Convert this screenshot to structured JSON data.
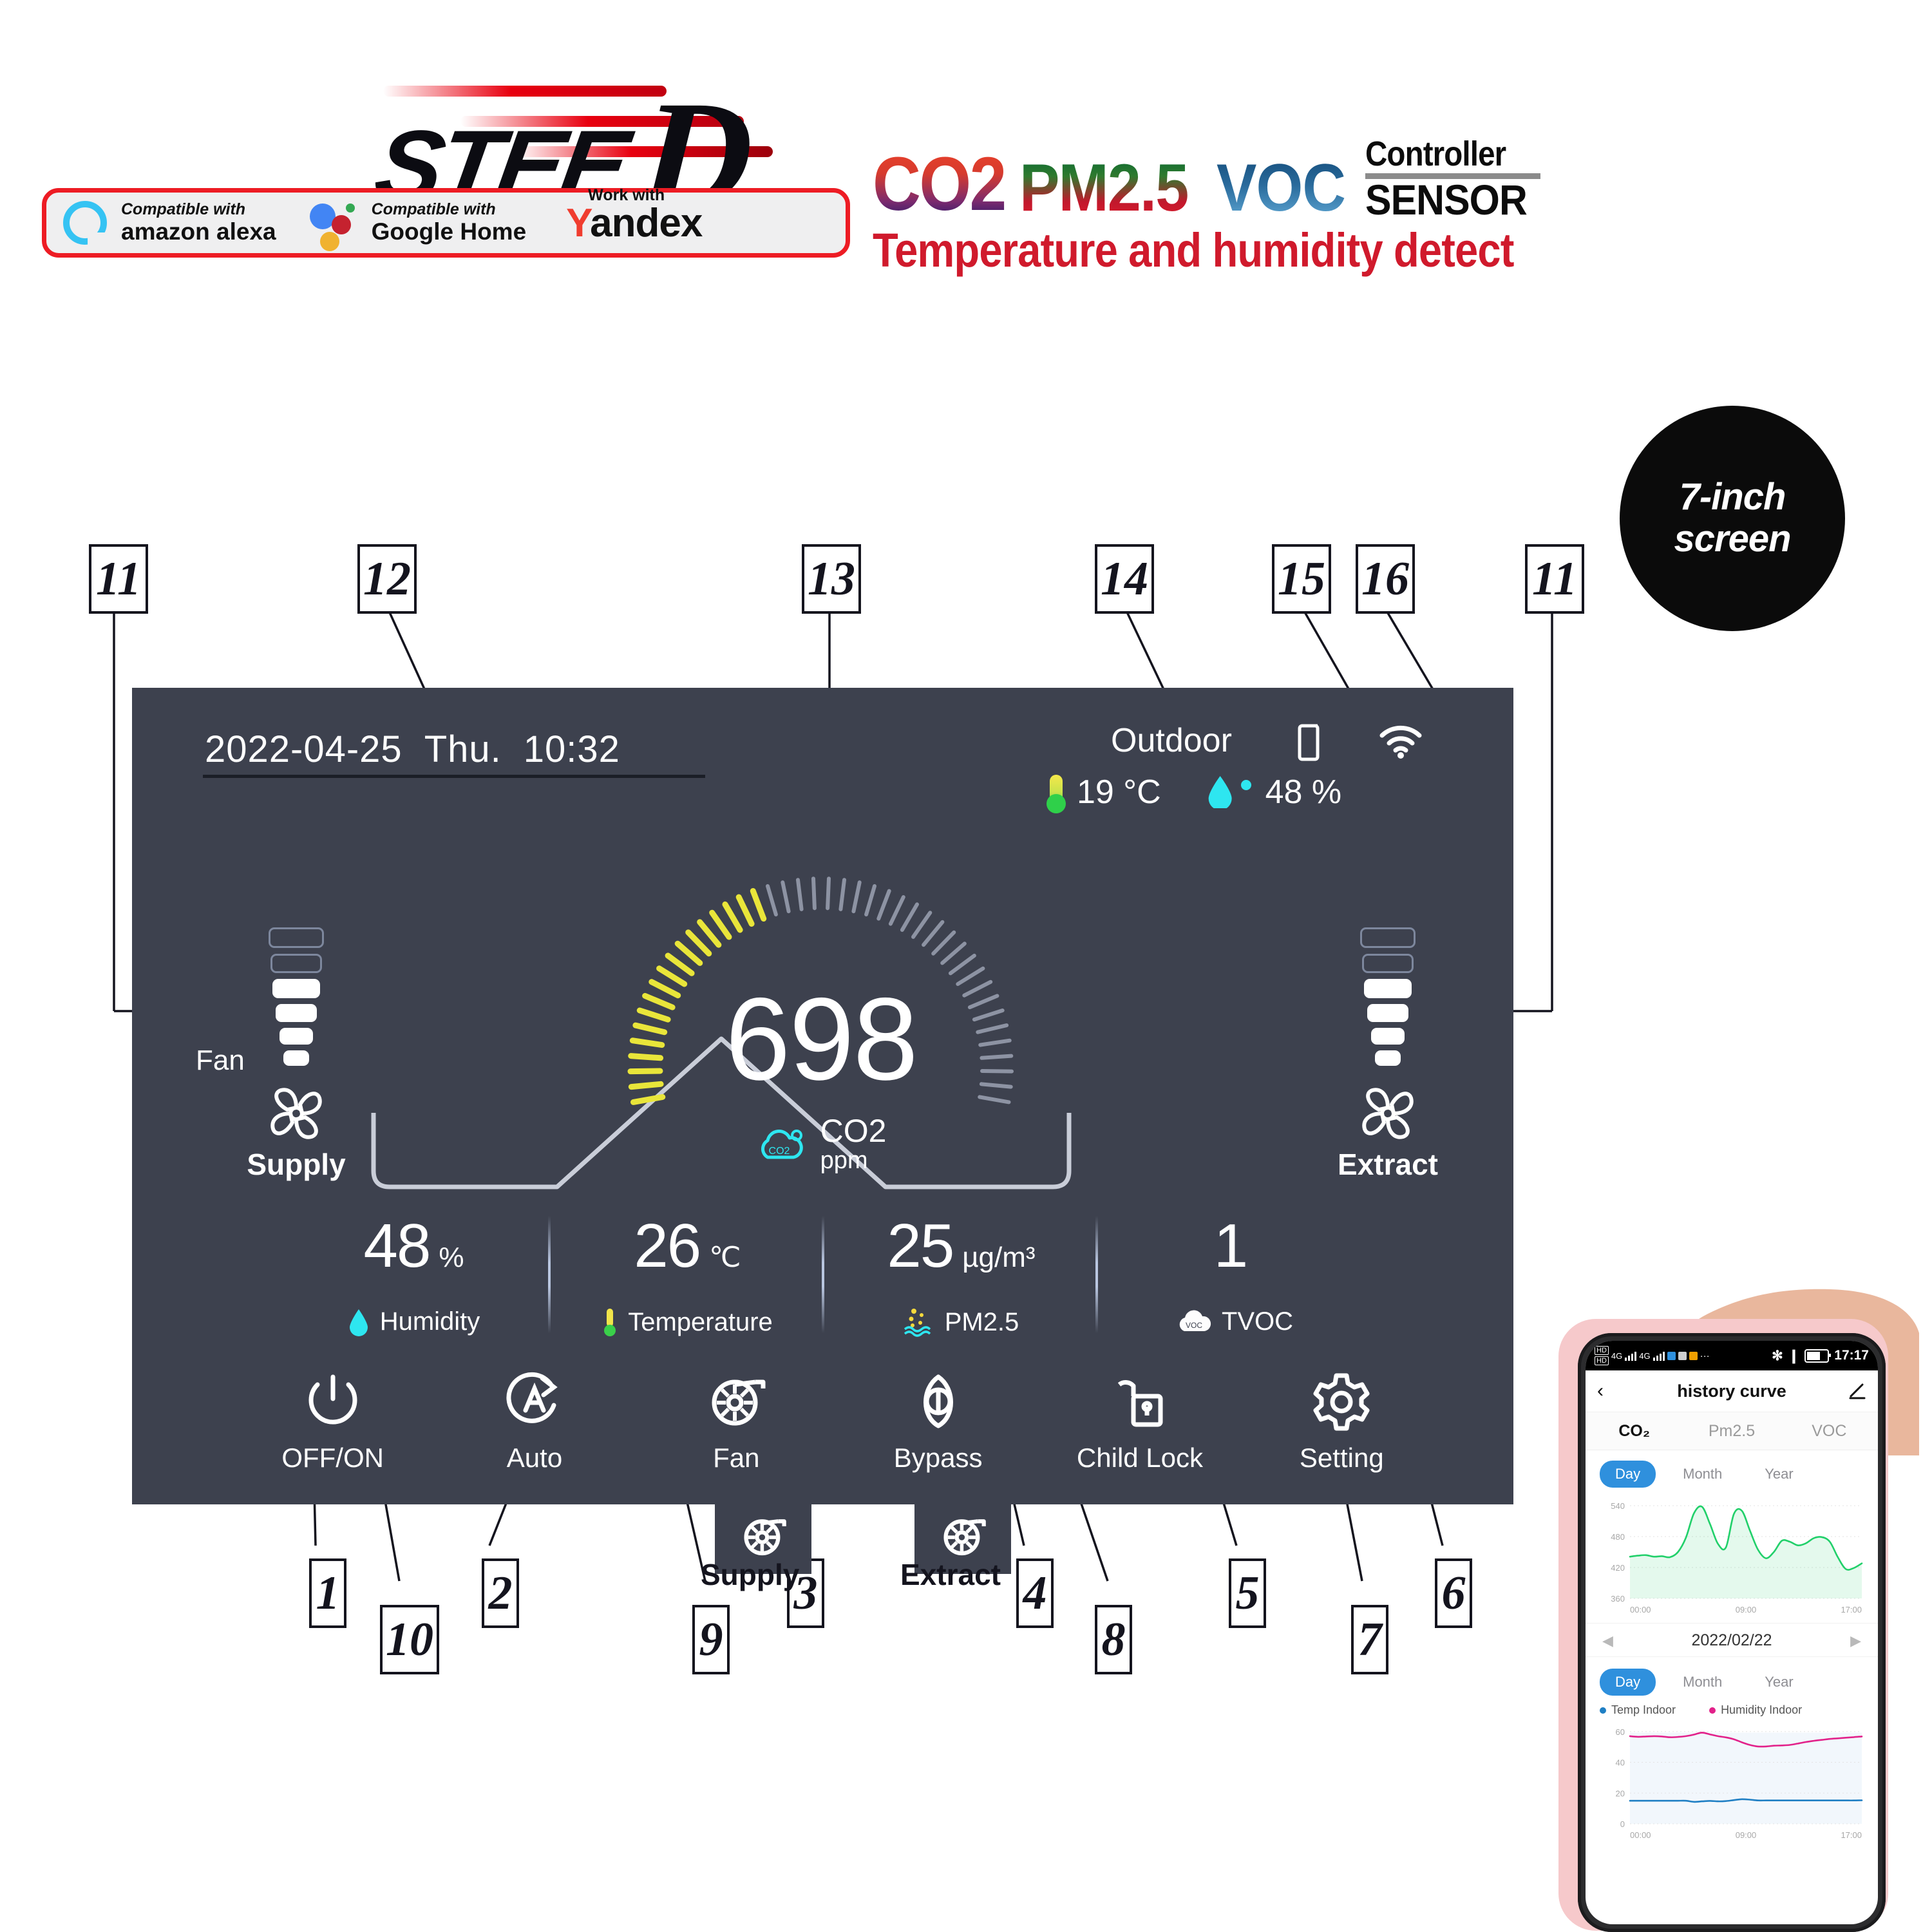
{
  "brand": {
    "logo_text": "STEE",
    "logo_text_d": "D",
    "compat": [
      {
        "icon": "alexa-ring-icon",
        "line1": "Compatible with",
        "line2": "amazon alexa"
      },
      {
        "icon": "google-assistant-dots-icon",
        "line1": "Compatible with",
        "line2": "Google Home"
      },
      {
        "icon": "yandex-icon",
        "line1": "Work with",
        "line2": "Yandex"
      }
    ]
  },
  "headline": {
    "co2": "CO2",
    "pm25": "PM2.5",
    "voc": "VOC",
    "controller": "Controller",
    "sensor": "SENSOR",
    "subtitle": "Temperature and humidity detect"
  },
  "screen_badge": {
    "line1": "7-inch",
    "line2": "screen"
  },
  "device": {
    "date": "2022-04-25",
    "weekday": "Thu.",
    "time": "10:32",
    "outdoor": {
      "title": "Outdoor",
      "temp": "19 °C",
      "humidity": "48 %",
      "tablet_icon": "tablet-icon",
      "wifi_icon": "wifi-icon"
    },
    "gauge": {
      "value": "698",
      "label": "CO2",
      "unit": "ppm",
      "icon": "co2-cloud-icon",
      "active_color": "#e9e53a",
      "inactive_color": "#8d93a3",
      "total_ticks": 44,
      "active_ticks": 18
    },
    "fan_left": {
      "fan_label": "Fan",
      "caption": "Supply",
      "icon": "fan-icon",
      "levels_total": 6,
      "levels_on": 4
    },
    "fan_right": {
      "caption": "Extract",
      "icon": "fan-icon",
      "levels_total": 6,
      "levels_on": 4
    },
    "readings": [
      {
        "num": "48",
        "unit": "%",
        "label": "Humidity",
        "icon": "droplet-icon"
      },
      {
        "num": "26",
        "unit": "℃",
        "label": "Temperature",
        "icon": "thermometer-icon"
      },
      {
        "num": "25",
        "unit": "µg/m³",
        "label": "PM2.5",
        "icon": "particles-icon"
      },
      {
        "num": "1",
        "unit": "",
        "label": "TVOC",
        "icon": "voc-cloud-icon"
      }
    ],
    "buttons": [
      {
        "label": "OFF/ON",
        "icon": "power-icon"
      },
      {
        "label": "Auto",
        "icon": "auto-icon"
      },
      {
        "label": "Fan",
        "icon": "blower-icon"
      },
      {
        "label": "Bypass",
        "icon": "bypass-icon"
      },
      {
        "label": "Child Lock",
        "icon": "lock-open-icon"
      },
      {
        "label": "Setting",
        "icon": "gear-icon"
      }
    ],
    "tab_stubs": [
      {
        "label": "Supply",
        "icon": "blower-icon"
      },
      {
        "label": "Extract",
        "icon": "blower-icon"
      }
    ]
  },
  "callouts": {
    "top": [
      {
        "n": "11"
      },
      {
        "n": "12"
      },
      {
        "n": "13"
      },
      {
        "n": "14"
      },
      {
        "n": "15"
      },
      {
        "n": "16"
      },
      {
        "n": "11"
      }
    ],
    "bottom": [
      {
        "n": "1"
      },
      {
        "n": "10"
      },
      {
        "n": "2"
      },
      {
        "n": "9"
      },
      {
        "n": "3"
      },
      {
        "n": "4"
      },
      {
        "n": "8"
      },
      {
        "n": "5"
      },
      {
        "n": "7"
      },
      {
        "n": "6"
      }
    ]
  },
  "phone": {
    "status": {
      "hd": "HD",
      "net4g": "4G",
      "time": "17:17"
    },
    "nav_title": "history curve",
    "back_icon": "chevron-left-icon",
    "edit_icon": "pencil-icon",
    "tabs": [
      {
        "label": "CO₂",
        "active": true
      },
      {
        "label": "Pm2.5",
        "active": false
      },
      {
        "label": "VOC",
        "active": false
      }
    ],
    "range_tabs": [
      {
        "label": "Day",
        "active": true
      },
      {
        "label": "Month",
        "active": false
      },
      {
        "label": "Year",
        "active": false
      }
    ],
    "date_nav": {
      "prev": "◀",
      "date": "2022/02/22",
      "next": "▶"
    },
    "legend": [
      {
        "label": "Temp Indoor",
        "color": "#1f7fc4"
      },
      {
        "label": "Humidity Indoor",
        "color": "#e2218a"
      }
    ]
  },
  "chart_data": [
    {
      "type": "area",
      "title": "CO2",
      "xlabel": "",
      "ylabel": "",
      "x": [
        "00:00",
        "09:00",
        "17:00"
      ],
      "xticks": [
        "00:00",
        "09:00",
        "17:00"
      ],
      "yticks": [
        360,
        420,
        480,
        540
      ],
      "ylim": [
        360,
        545
      ],
      "grid": true,
      "legend_position": "none",
      "series": [
        {
          "name": "CO2",
          "color": "#21d06a",
          "values": [
            441,
            443,
            444,
            441,
            442,
            440,
            450,
            478,
            525,
            538,
            505,
            466,
            459,
            524,
            530,
            492,
            455,
            438,
            450,
            472,
            470,
            463,
            467,
            477,
            479,
            470,
            440,
            417,
            419,
            428
          ]
        }
      ]
    },
    {
      "type": "line",
      "title": "",
      "xlabel": "",
      "ylabel": "",
      "xticks": [
        "00:00",
        "09:00",
        "17:00"
      ],
      "yticks": [
        0,
        20,
        40,
        60
      ],
      "ylim": [
        0,
        62
      ],
      "grid": true,
      "legend_position": "top",
      "series": [
        {
          "name": "Temp Indoor",
          "color": "#1f7fc4",
          "values": [
            15,
            15,
            15,
            15,
            15,
            15,
            15,
            15,
            14.3,
            14.6,
            14.9,
            14.6,
            14.8,
            15.4,
            16,
            15.7,
            15.2,
            15.2,
            15.2,
            15.2,
            15.2,
            15.2,
            15.2,
            15.2,
            15.2,
            15.2,
            15.2,
            15.2,
            15.2,
            15.3
          ]
        },
        {
          "name": "Humidity Indoor",
          "color": "#e2218a",
          "values": [
            57,
            56.6,
            56.8,
            57,
            56.8,
            56.3,
            56.5,
            57,
            58,
            59.3,
            58.2,
            57,
            56.2,
            55,
            53,
            51.3,
            50.3,
            50.3,
            50.8,
            51,
            51.3,
            52.2,
            53.2,
            54,
            54.6,
            55.2,
            55.6,
            56,
            56.4,
            56.8
          ]
        }
      ]
    }
  ]
}
